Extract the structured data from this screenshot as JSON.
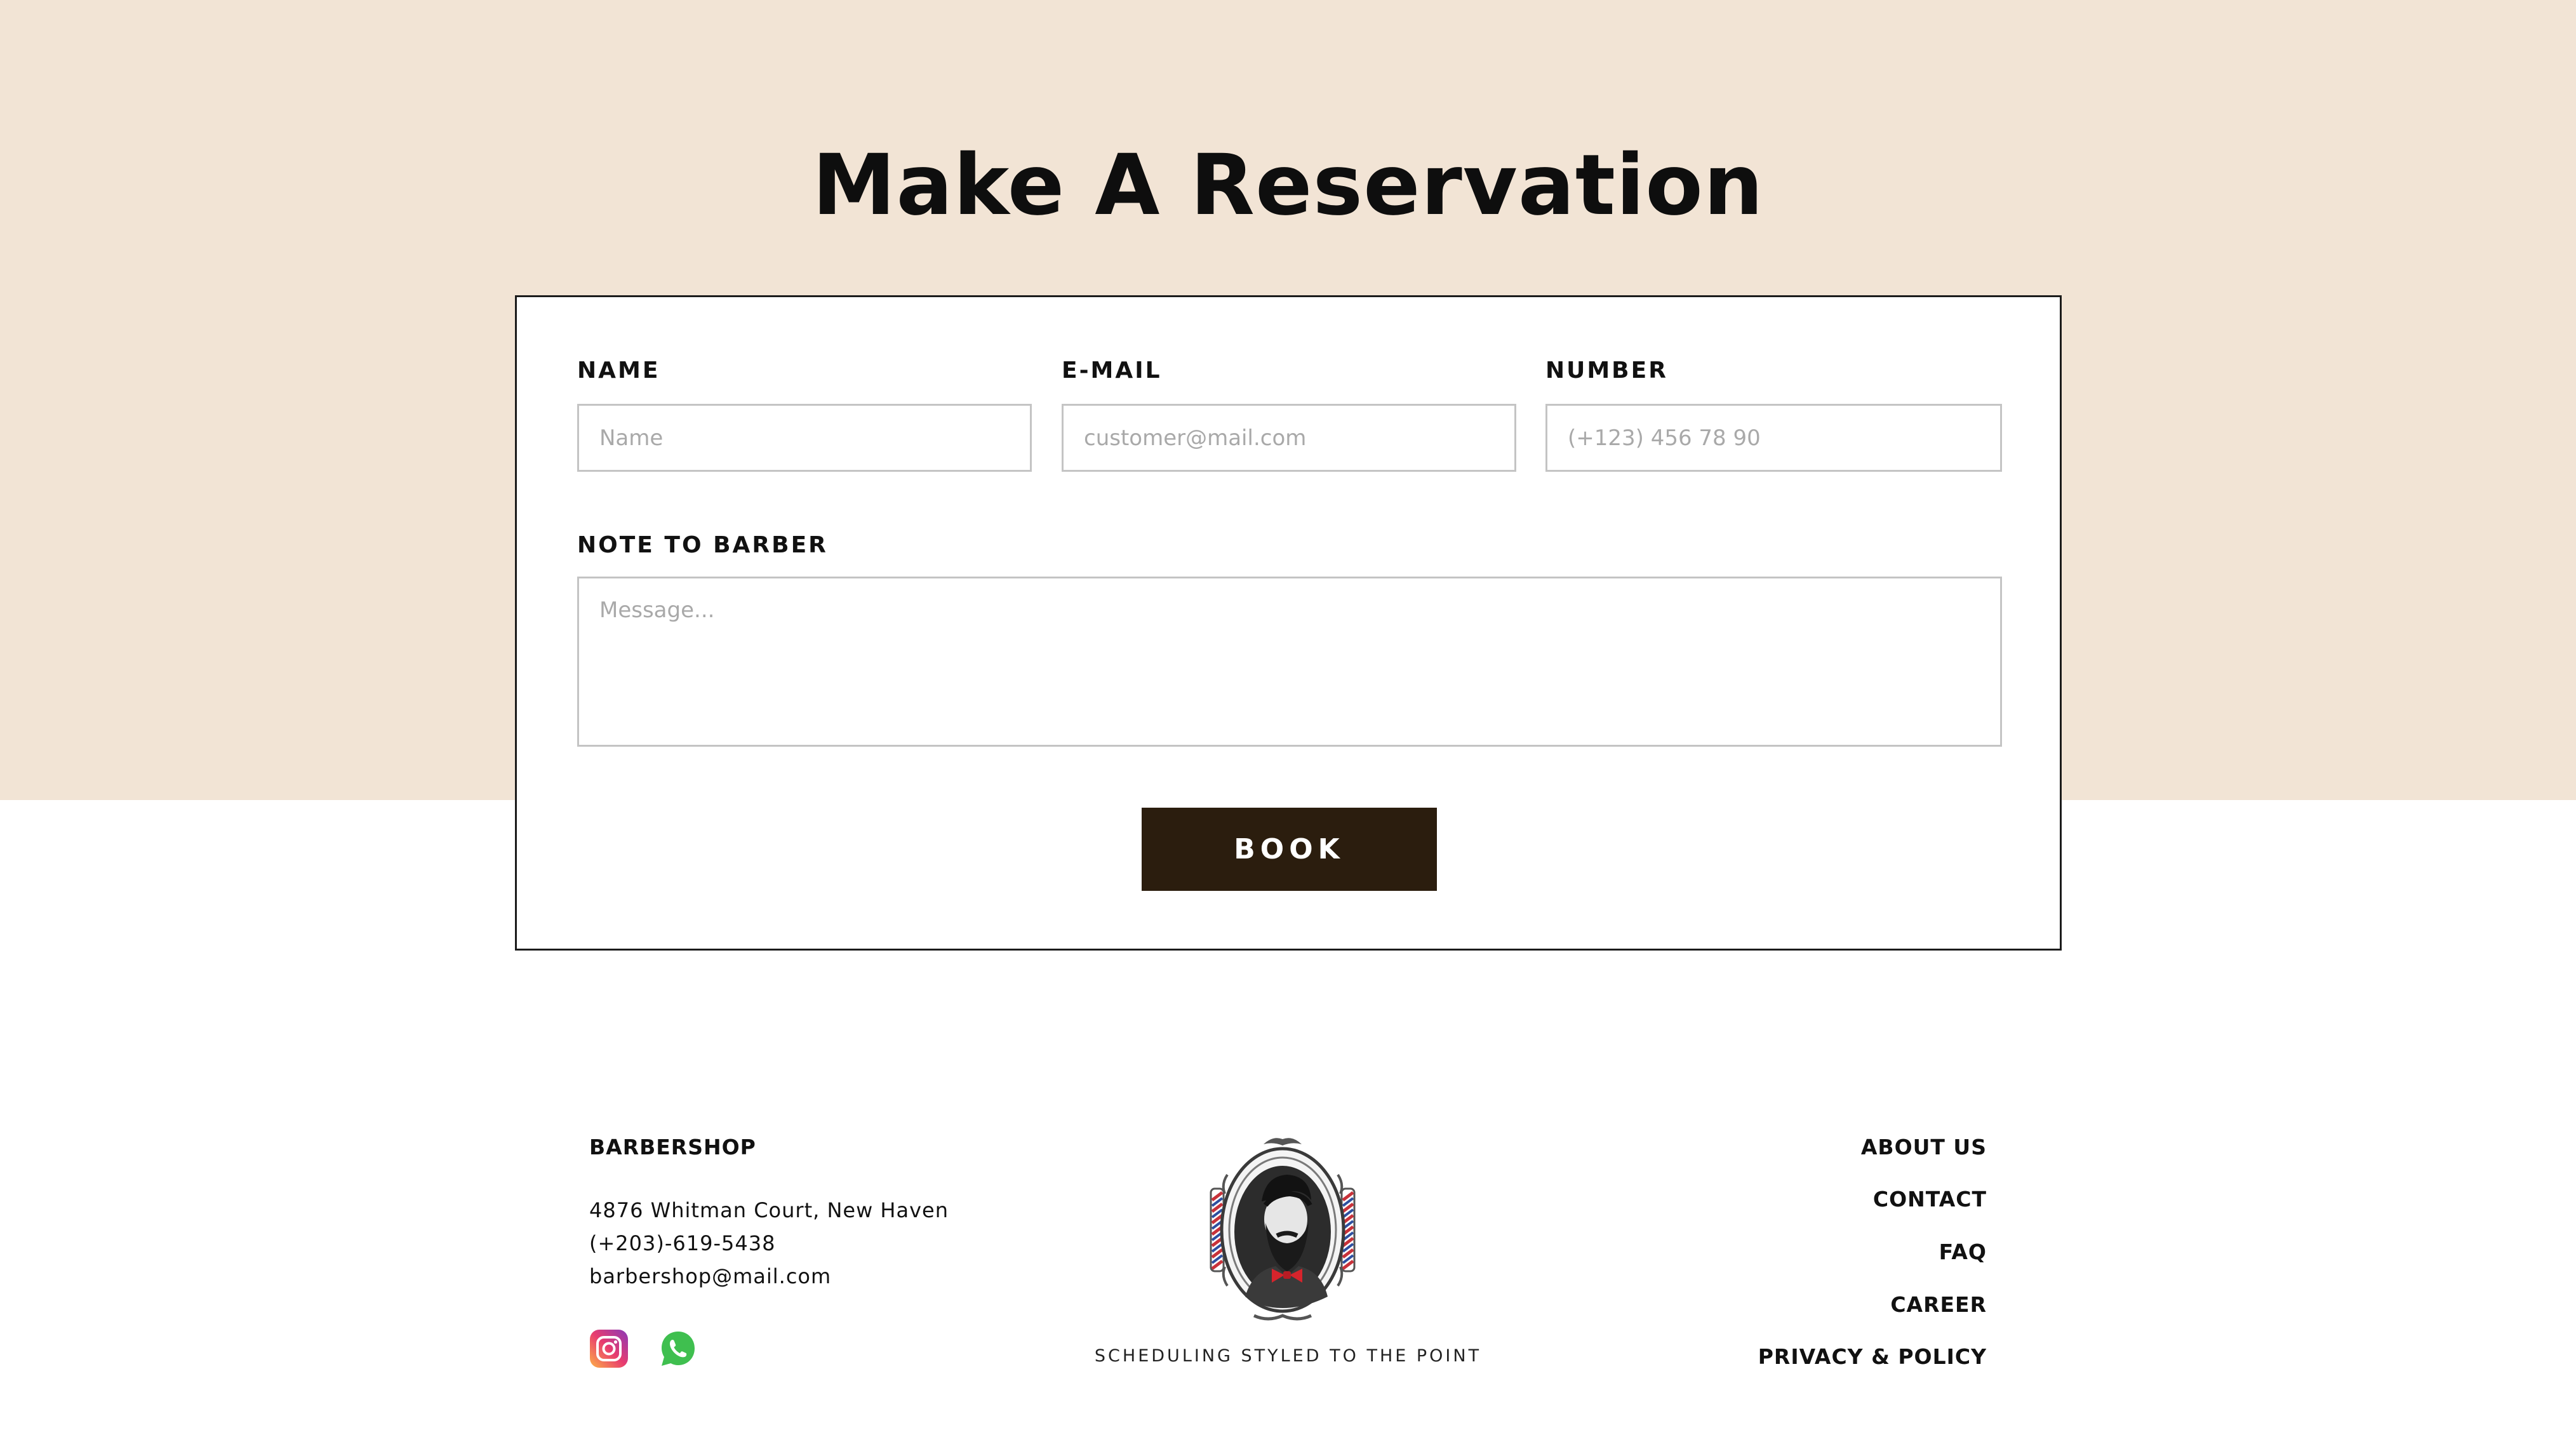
{
  "page": {
    "title": "Make A Reservation"
  },
  "form": {
    "name": {
      "label": "NAME",
      "placeholder": "Name",
      "value": ""
    },
    "email": {
      "label": "E-MAIL",
      "placeholder": "customer@mail.com",
      "value": ""
    },
    "number": {
      "label": "NUMBER",
      "placeholder": "(+123) 456 78 90",
      "value": ""
    },
    "note": {
      "label": "NOTE TO BARBER",
      "placeholder": "Message...",
      "value": ""
    },
    "submit_label": "BOOK"
  },
  "footer": {
    "brand": "BARBERSHOP",
    "address": "4876 Whitman Court, New Haven",
    "phone": "(+203)-619-5438",
    "email": "barbershop@mail.com",
    "social": [
      {
        "icon": "instagram-icon"
      },
      {
        "icon": "whatsapp-icon"
      }
    ],
    "tagline": "SCHEDULING STYLED TO THE POINT",
    "links": [
      "ABOUT US",
      "CONTACT",
      "FAQ",
      "CAREER",
      "PRIVACY & POLICY"
    ]
  },
  "colors": {
    "hero_background": "#f2e4d5",
    "button_background": "#2b1d0e",
    "card_border": "#1c1c1c",
    "input_border": "#c4c4c4"
  }
}
